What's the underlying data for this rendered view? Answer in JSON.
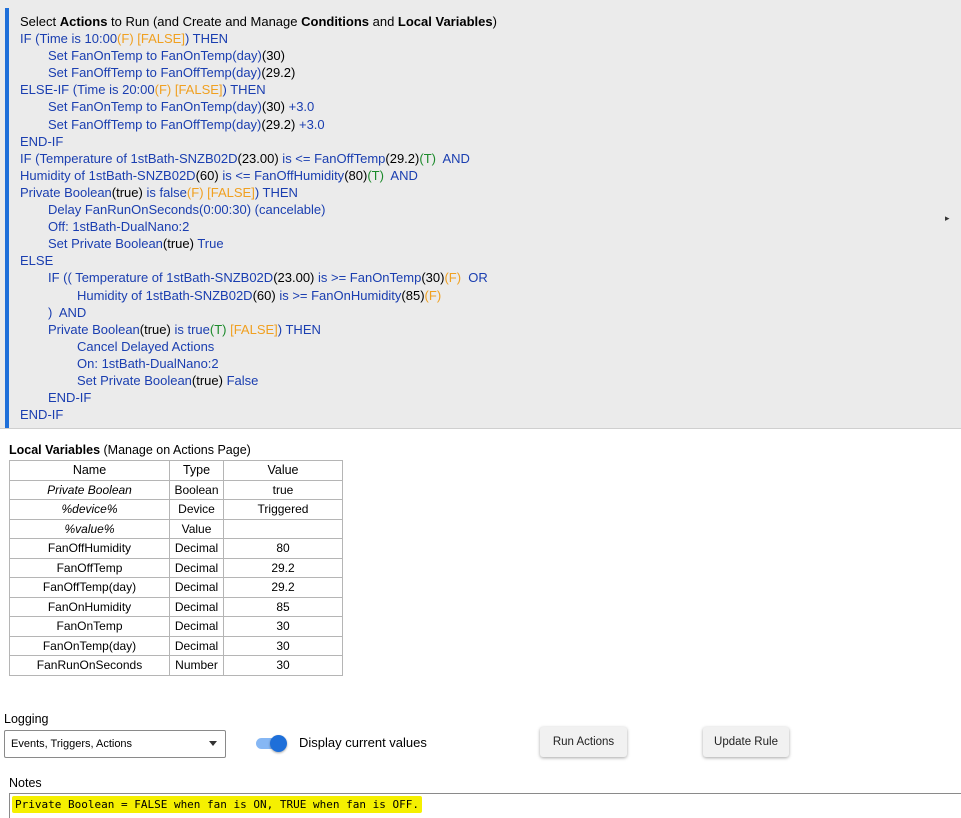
{
  "rule": {
    "header": {
      "pre": "Select ",
      "actions": "Actions",
      "mid1": " to Run (and Create and Manage ",
      "conditions": "Conditions",
      "mid2": " and ",
      "locals": "Local Variables",
      "post": ")"
    },
    "lines": {
      "l1_a": "IF (Time is 10:00",
      "l1_b": "(F) [FALSE]",
      "l1_c": ") THEN",
      "l2_a": "Set FanOnTemp to FanOnTemp(day)",
      "l2_b": "(30)",
      "l3_a": "Set FanOffTemp to FanOffTemp(day)",
      "l3_b": "(29.2)",
      "l4_a": "ELSE-IF (Time is 20:00",
      "l4_b": "(F) [FALSE]",
      "l4_c": ") THEN",
      "l5_a": "Set FanOnTemp to FanOnTemp(day)",
      "l5_b": "(30)",
      "l5_c": " +3.0",
      "l6_a": "Set FanOffTemp to FanOffTemp(day)",
      "l6_b": "(29.2)",
      "l6_c": " +3.0",
      "l7": "END-IF",
      "l8_a": "IF (Temperature of 1stBath-SNZB02D",
      "l8_b": "(23.00)",
      "l8_c": " is <= FanOffTemp",
      "l8_d": "(29.2)",
      "l8_e": "(T)",
      "l8_f": "  AND",
      "l9_a": "Humidity of 1stBath-SNZB02D",
      "l9_b": "(60)",
      "l9_c": " is <= FanOffHumidity",
      "l9_d": "(80)",
      "l9_e": "(T)",
      "l9_f": "  AND",
      "l10_a": "Private Boolean",
      "l10_b": "(true)",
      "l10_c": " is false",
      "l10_d": "(F) [FALSE]",
      "l10_e": ") THEN",
      "l11": "Delay FanRunOnSeconds(0:00:30) (cancelable)",
      "l12": "Off: 1stBath-DualNano:2",
      "l13_a": "Set Private Boolean",
      "l13_b": "(true)",
      "l13_c": " True",
      "l14": "ELSE",
      "l15_a": "IF (( Temperature of 1stBath-SNZB02D",
      "l15_b": "(23.00)",
      "l15_c": " is >= FanOnTemp",
      "l15_d": "(30)",
      "l15_e": "(F)",
      "l15_f": "  OR",
      "l16_a": "Humidity of 1stBath-SNZB02D",
      "l16_b": "(60)",
      "l16_c": " is >= FanOnHumidity",
      "l16_d": "(85)",
      "l16_e": "(F)",
      "l17_a": ")",
      "l17_b": "  AND",
      "l18_a": "Private Boolean",
      "l18_b": "(true)",
      "l18_c": " is true",
      "l18_d": "(T)",
      "l18_e": " [FALSE]",
      "l18_f": ") THEN",
      "l19": "Cancel Delayed Actions",
      "l20": "On: 1stBath-DualNano:2",
      "l21_a": "Set Private Boolean",
      "l21_b": "(true)",
      "l21_c": " False",
      "l22": "END-IF",
      "l23": "END-IF"
    },
    "expand_glyph": "▸"
  },
  "local_variables": {
    "title_bold": "Local Variables",
    "title_rest": " (Manage on Actions Page)",
    "columns": {
      "name": "Name",
      "type": "Type",
      "value": "Value"
    },
    "rows": [
      {
        "name": "Private Boolean",
        "type": "Boolean",
        "value": "true"
      },
      {
        "name": "%device%",
        "type": "Device",
        "value": "Triggered"
      },
      {
        "name": "%value%",
        "type": "Value",
        "value": ""
      },
      {
        "name": "FanOffHumidity",
        "type": "Decimal",
        "value": "80"
      },
      {
        "name": "FanOffTemp",
        "type": "Decimal",
        "value": "29.2"
      },
      {
        "name": "FanOffTemp(day)",
        "type": "Decimal",
        "value": "29.2"
      },
      {
        "name": "FanOnHumidity",
        "type": "Decimal",
        "value": "85"
      },
      {
        "name": "FanOnTemp",
        "type": "Decimal",
        "value": "30"
      },
      {
        "name": "FanOnTemp(day)",
        "type": "Decimal",
        "value": "30"
      },
      {
        "name": "FanRunOnSeconds",
        "type": "Number",
        "value": "30"
      }
    ]
  },
  "controls": {
    "logging_label": "Logging",
    "logging_value": "Events, Triggers, Actions",
    "display_current_values": "Display current values",
    "display_current_values_on": true,
    "run_actions": "Run Actions",
    "update_rule": "Update Rule"
  },
  "notes": {
    "label": "Notes",
    "text": "Private Boolean = FALSE when fan is ON, TRUE when fan is OFF."
  },
  "colors": {
    "keyword_blue": "#1a3eb0",
    "state_orange": "#f0a020",
    "true_green": "#1b8a2a",
    "accent_blue": "#1e6fd9",
    "highlight_yellow": "#f5f000"
  }
}
